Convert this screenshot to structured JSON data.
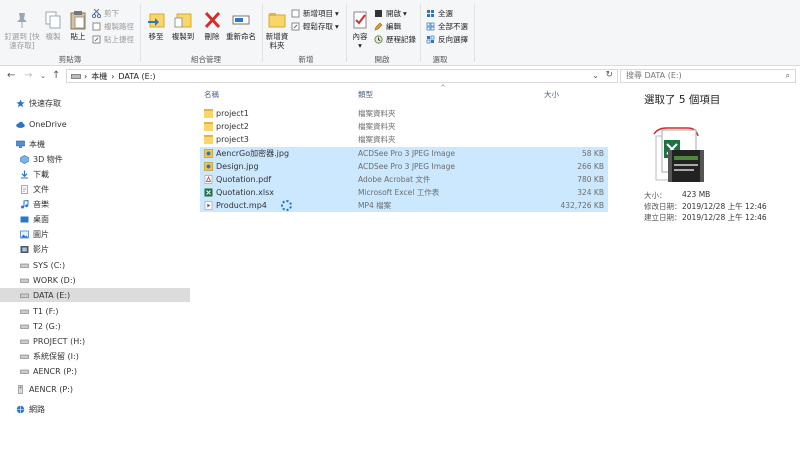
{
  "ribbon": {
    "clipboard": {
      "pin": "釘選到 [快速存取]",
      "copy": "複製",
      "paste": "貼上",
      "cut": "剪下",
      "copy_path": "複製路徑",
      "paste_shortcut": "貼上捷徑",
      "group": "剪貼簿"
    },
    "organize": {
      "move_to": "移至",
      "copy_to": "複製到",
      "delete": "刪除",
      "rename": "重新命名",
      "group": "組合管理"
    },
    "new": {
      "new_folder": "新增資料夾",
      "new_item": "新增項目",
      "easy_access": "輕鬆存取",
      "group": "新增"
    },
    "open": {
      "properties": "內容",
      "open": "開啟",
      "edit": "編輯",
      "history": "歷程記錄",
      "group": "開啟"
    },
    "select": {
      "select_all": "全選",
      "select_none": "全部不選",
      "invert": "反向選擇",
      "group": "選取"
    }
  },
  "address": {
    "crumbs": [
      "本機",
      "DATA (E:)"
    ],
    "search_placeholder": "搜尋 DATA (E:)"
  },
  "nav": {
    "quick_access": "快速存取",
    "onedrive": "OneDrive",
    "this_pc": "本機",
    "objects3d": "3D 物件",
    "downloads": "下載",
    "documents": "文件",
    "music": "音樂",
    "desktop": "桌面",
    "pictures": "圖片",
    "videos": "影片",
    "sys": "SYS (C:)",
    "work": "WORK (D:)",
    "data": "DATA (E:)",
    "t1": "T1 (F:)",
    "t2": "T2 (G:)",
    "project": "PROJECT (H:)",
    "reserved": "系統保留 (I:)",
    "aencr": "AENCR (P:)",
    "aencr2": "AENCR (P:)",
    "network": "網路"
  },
  "columns": {
    "name": "名稱",
    "type": "類型",
    "size": "大小"
  },
  "files": [
    {
      "name": "project1",
      "type": "檔案資料夾",
      "size": ""
    },
    {
      "name": "project2",
      "type": "檔案資料夾",
      "size": ""
    },
    {
      "name": "project3",
      "type": "檔案資料夾",
      "size": ""
    },
    {
      "name": "AencrGo加密器.jpg",
      "type": "ACDSee Pro 3 JPEG Image",
      "size": "58 KB"
    },
    {
      "name": "Design.jpg",
      "type": "ACDSee Pro 3 JPEG Image",
      "size": "266 KB"
    },
    {
      "name": "Quotation.pdf",
      "type": "Adobe Acrobat 文件",
      "size": "780 KB"
    },
    {
      "name": "Quotation.xlsx",
      "type": "Microsoft Excel 工作表",
      "size": "324 KB"
    },
    {
      "name": "Product.mp4",
      "type": "MP4 檔案",
      "size": "432,726 KB"
    }
  ],
  "details": {
    "count": "選取了 5 個項目",
    "size_label": "大小：",
    "size_value": "423 MB",
    "modified_label": "修改日期：",
    "modified_value": "2019/12/28 上午 12:46",
    "created_label": "建立日期：",
    "created_value": "2019/12/28 上午 12:46"
  },
  "colors": {
    "selection": "#cce8ff",
    "folder": "#f8d66a",
    "accent": "#1a73c8"
  }
}
